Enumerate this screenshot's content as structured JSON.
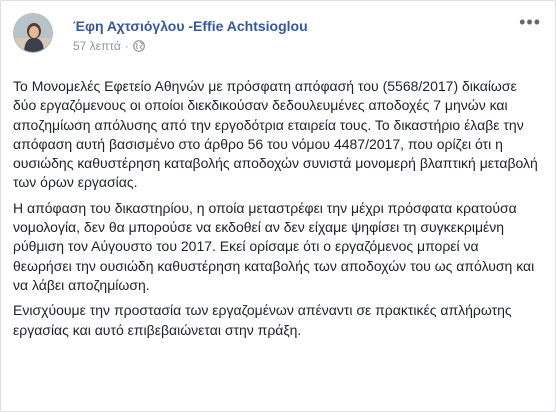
{
  "post": {
    "author": "Έφη Αχτσιόγλου -Effie Achtsioglou",
    "time": "57 λεπτά",
    "separator": "·",
    "privacy_icon": "globe-icon",
    "more_icon": "more-options-icon",
    "more_label": "•••",
    "paragraphs": [
      "Το Μονομελές Εφετείο Αθηνών με πρόσφατη απόφασή του (5568/2017) δικαίωσε δύο εργαζόμενους οι οποίοι διεκδικούσαν δεδουλευμένες αποδοχές 7 μηνών και αποζημίωση απόλυσης από την εργοδότρια εταιρεία τους. Το δικαστήριο έλαβε την απόφαση αυτή βασισμένο στο άρθρο 56 του νόμου 4487/2017, που ορίζει ότι η ουσιώδης καθυστέρηση καταβολής αποδοχών συνιστά μονομερή βλαπτική μεταβολή των όρων εργασίας.",
      "Η απόφαση του δικαστηρίου, η οποία μεταστρέφει την μέχρι πρόσφατα κρατούσα νομολογία, δεν θα μπορούσε να εκδοθεί αν δεν είχαμε ψηφίσει τη συγκεκριμένη ρύθμιση τον Αύγουστο του 2017. Εκεί ορίσαμε ότι ο εργαζόμενος μπορεί να θεωρήσει την ουσιώδη καθυστέρηση καταβολής των αποδοχών του ως απόλυση και να λάβει αποζημίωση.",
      "Ενισχύουμε την προστασία των εργαζομένων απέναντι σε πρακτικές απλήρωτης εργασίας και αυτό επιβεβαιώνεται στην πράξη."
    ]
  },
  "colors": {
    "author_link": "#365899",
    "meta_text": "#90949c",
    "body_text": "#1d2129"
  }
}
